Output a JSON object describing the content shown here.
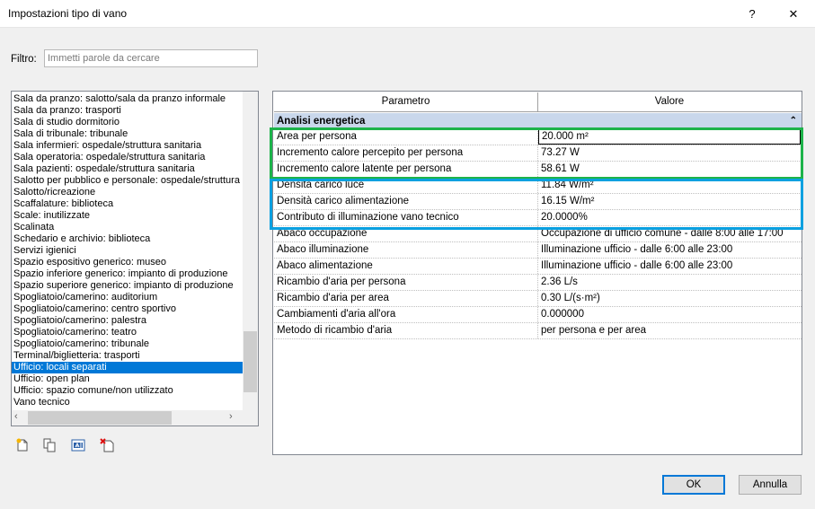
{
  "window": {
    "title": "Impostazioni tipo di vano",
    "help_label": "?",
    "close_label": "✕"
  },
  "filter": {
    "label": "Filtro:",
    "placeholder": "Immetti parole da cercare"
  },
  "list": {
    "items": [
      "Sala da pranzo: salotto/sala da pranzo informale",
      "Sala da pranzo: trasporti",
      "Sala di studio dormitorio",
      "Sala di tribunale: tribunale",
      "Sala infermieri: ospedale/struttura sanitaria",
      "Sala operatoria: ospedale/struttura sanitaria",
      "Sala pazienti: ospedale/struttura sanitaria",
      "Salotto per pubblico e personale: ospedale/struttura",
      "Salotto/ricreazione",
      "Scaffalature: biblioteca",
      "Scale: inutilizzate",
      "Scalinata",
      "Schedario e archivio: biblioteca",
      "Servizi igienici",
      "Spazio espositivo generico: museo",
      "Spazio inferiore generico: impianto di produzione",
      "Spazio superiore generico: impianto di produzione",
      "Spogliatoio/camerino: auditorium",
      "Spogliatoio/camerino: centro sportivo",
      "Spogliatoio/camerino: palestra",
      "Spogliatoio/camerino: teatro",
      "Spogliatoio/camerino: tribunale",
      "Terminal/biglietteria: trasporti",
      "Ufficio: locali separati",
      "Ufficio: open plan",
      "Ufficio: spazio comune/non utilizzato",
      "Vano tecnico"
    ],
    "selected_index": 23,
    "scroll_left": "‹",
    "scroll_right": "›"
  },
  "toolbar_icons": [
    "new-type-icon",
    "duplicate-icon",
    "rename-icon",
    "delete-icon"
  ],
  "grid": {
    "header_param": "Parametro",
    "header_value": "Valore",
    "group_label": "Analisi energetica",
    "collapse_glyph": "⌃",
    "rows": [
      {
        "param": "Area per persona",
        "value": "20.000 m²"
      },
      {
        "param": "Incremento calore percepito per persona",
        "value": "73.27 W"
      },
      {
        "param": "Incremento calore latente per persona",
        "value": "58.61 W"
      },
      {
        "param": "Densità carico luce",
        "value": "11.84 W/m²"
      },
      {
        "param": "Densità carico alimentazione",
        "value": "16.15 W/m²"
      },
      {
        "param": "Contributo di illuminazione vano tecnico",
        "value": "20.0000%"
      },
      {
        "param": "Abaco occupazione",
        "value": "Occupazione di ufficio comune - dalle 8:00 alle 17:00"
      },
      {
        "param": "Abaco illuminazione",
        "value": "Illuminazione ufficio - dalle 6:00 alle 23:00"
      },
      {
        "param": "Abaco alimentazione",
        "value": "Illuminazione ufficio - dalle 6:00 alle 23:00"
      },
      {
        "param": "Ricambio d'aria per persona",
        "value": "2.36 L/s"
      },
      {
        "param": "Ricambio d'aria per area",
        "value": "0.30 L/(s·m²)"
      },
      {
        "param": "Cambiamenti d'aria all'ora",
        "value": "0.000000"
      },
      {
        "param": "Metodo di ricambio d'aria",
        "value": "per persona e per area"
      }
    ]
  },
  "highlight_colors": {
    "green": "#1db34a",
    "blue": "#0aa0e0"
  },
  "buttons": {
    "ok": "OK",
    "cancel": "Annulla"
  }
}
